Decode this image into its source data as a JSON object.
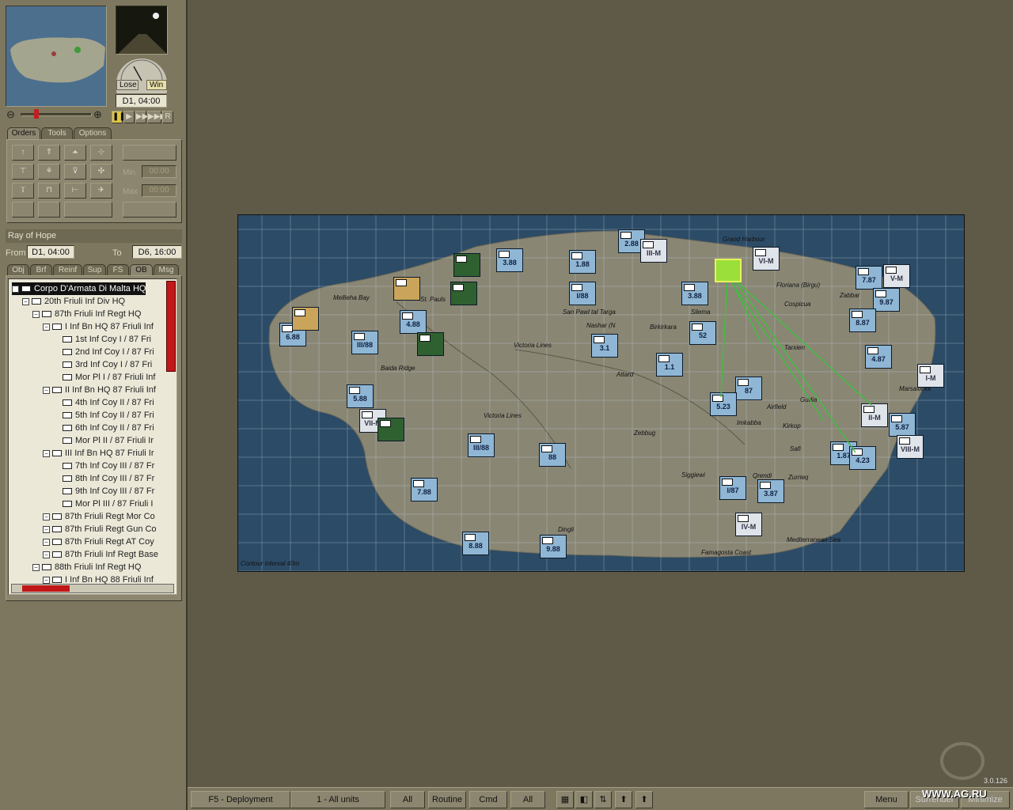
{
  "clock": {
    "time": "D1, 04:00",
    "lose": "Lose",
    "win": "Win"
  },
  "speed": {
    "replay": "R"
  },
  "tabs": {
    "orders": "Orders",
    "tools": "Tools",
    "options": "Options"
  },
  "orders": {
    "min_label": "Min",
    "max_label": "Max",
    "min_val": "00:00",
    "max_val": "00:00"
  },
  "objective": {
    "name": "Ray of Hope",
    "from_label": "From",
    "from": "D1, 04:00",
    "to_label": "To",
    "to": "D6, 16:00"
  },
  "subtabs": [
    "Obj",
    "Brf",
    "Reinf",
    "Sup",
    "FS",
    "OB",
    "Msg"
  ],
  "ob_tree": [
    {
      "indent": 0,
      "label": "Corpo D'Armata Di Malta HQ",
      "sel": true
    },
    {
      "indent": 1,
      "label": "20th Friuli Inf Div HQ"
    },
    {
      "indent": 2,
      "label": "87th Friuli Inf Regt HQ"
    },
    {
      "indent": 3,
      "label": "I Inf Bn HQ 87 Friuli Inf"
    },
    {
      "indent": 4,
      "label": "1st Inf Coy I / 87 Fri"
    },
    {
      "indent": 4,
      "label": "2nd Inf Coy I / 87 Fri"
    },
    {
      "indent": 4,
      "label": "3rd Inf Coy I / 87 Fri"
    },
    {
      "indent": 4,
      "label": "Mor Pl I / 87 Friuli Inf"
    },
    {
      "indent": 3,
      "label": "II Inf Bn HQ 87 Friuli Inf"
    },
    {
      "indent": 4,
      "label": "4th Inf Coy II / 87 Fri"
    },
    {
      "indent": 4,
      "label": "5th Inf Coy II / 87 Fri"
    },
    {
      "indent": 4,
      "label": "6th Inf Coy II / 87 Fri"
    },
    {
      "indent": 4,
      "label": "Mor Pl II / 87 Friuli Ir"
    },
    {
      "indent": 3,
      "label": "III Inf Bn HQ 87 Friuli Ir"
    },
    {
      "indent": 4,
      "label": "7th Inf Coy III / 87 Fr"
    },
    {
      "indent": 4,
      "label": "8th Inf Coy III / 87 Fr"
    },
    {
      "indent": 4,
      "label": "9th Inf Coy III / 87 Fr"
    },
    {
      "indent": 4,
      "label": "Mor Pl III / 87 Friuli I"
    },
    {
      "indent": 3,
      "label": "87th Friuli Regt Mor Co"
    },
    {
      "indent": 3,
      "label": "87th Friuli Regt Gun Co"
    },
    {
      "indent": 3,
      "label": "87th Friuli Regt AT Coy"
    },
    {
      "indent": 3,
      "label": "87th Friuli Inf Regt Base"
    },
    {
      "indent": 2,
      "label": "88th Friuli Inf Regt HQ"
    },
    {
      "indent": 3,
      "label": "I Inf Bn HQ 88 Friuli Inf"
    }
  ],
  "bottom": {
    "deploy": "F5 - Deployment",
    "units": "1 - All units",
    "all1": "All",
    "routine": "Routine",
    "cmd": "Cmd",
    "all2": "All",
    "menu": "Menu",
    "surrender": "Surrender",
    "minimize": "Minimize"
  },
  "version": "3.0.126",
  "watermark": "WWW.AG.RU",
  "map": {
    "places": [
      "Mellieha Bay",
      "St. Pauls",
      "Baida Ridge",
      "Victoria Lines",
      "Nashar (N",
      "San Pawl tal Targa",
      "Birkirkara",
      "Attard",
      "Zebbug",
      "Siggiewi",
      "Dingli",
      "Imkabba",
      "Safi",
      "Gudia",
      "Zabbar",
      "Cospicua",
      "Marsaxlokk",
      "Mediterranean Sea",
      "Famagosta Coast",
      "Contour interval 40m",
      "Grand Harbour",
      "Floriana (Birgu)",
      "Victoria Lines",
      "Qrendi",
      "Zurrieq",
      "Kirkop",
      "Airfield",
      "Tarxien",
      "Sliema"
    ],
    "units": [
      {
        "v": "3.88",
        "c": "b"
      },
      {
        "v": "1.88",
        "c": "b"
      },
      {
        "v": "I/88",
        "c": "b"
      },
      {
        "v": "2.88",
        "c": "b"
      },
      {
        "v": "III-M",
        "c": "w"
      },
      {
        "v": "VI-M",
        "c": "w"
      },
      {
        "v": "7.87",
        "c": "b"
      },
      {
        "v": "V-M",
        "c": "w"
      },
      {
        "v": "9.87",
        "c": "b"
      },
      {
        "v": "8.87",
        "c": "b"
      },
      {
        "v": "4.87",
        "c": "b"
      },
      {
        "v": "I-M",
        "c": "w"
      },
      {
        "v": "II-M",
        "c": "w"
      },
      {
        "v": "5.87",
        "c": "b"
      },
      {
        "v": "VIII-M",
        "c": "w"
      },
      {
        "v": "6.88",
        "c": "b"
      },
      {
        "v": "III/88",
        "c": "b"
      },
      {
        "v": "4.88",
        "c": "b"
      },
      {
        "v": "5.88",
        "c": "b"
      },
      {
        "v": "VII-M",
        "c": "w"
      },
      {
        "v": "III/88",
        "c": "b"
      },
      {
        "v": "7.88",
        "c": "b"
      },
      {
        "v": "8.88",
        "c": "b"
      },
      {
        "v": "9.88",
        "c": "b"
      },
      {
        "v": "88",
        "c": "b"
      },
      {
        "v": "3.1",
        "c": "b"
      },
      {
        "v": "1.1",
        "c": "b"
      },
      {
        "v": "52",
        "c": "b"
      },
      {
        "v": "87",
        "c": "b"
      },
      {
        "v": "5.23",
        "c": "b"
      },
      {
        "v": "I/87",
        "c": "b"
      },
      {
        "v": "3.87",
        "c": "b"
      },
      {
        "v": "IV-M",
        "c": "w"
      },
      {
        "v": "1.87",
        "c": "b"
      },
      {
        "v": "4.23",
        "c": "b"
      },
      {
        "v": "3.88",
        "c": "b"
      }
    ]
  }
}
